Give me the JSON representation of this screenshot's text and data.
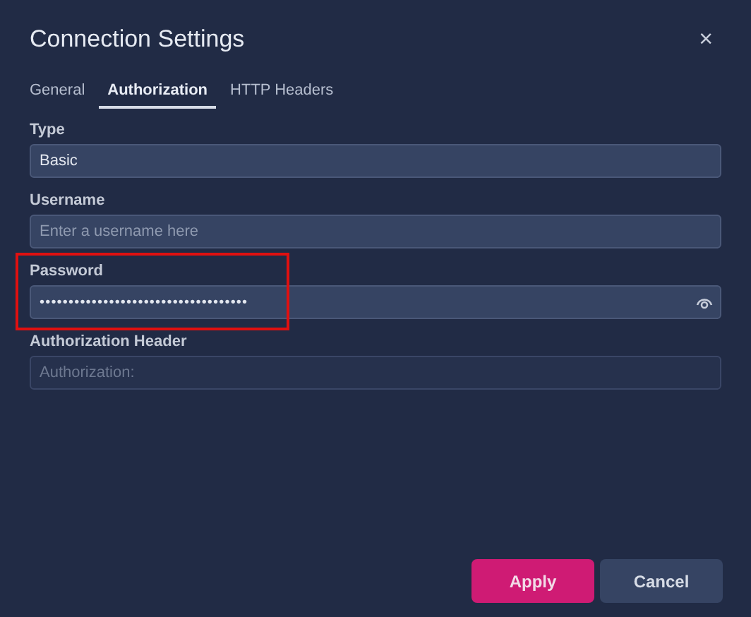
{
  "dialog": {
    "title": "Connection Settings",
    "close": "×"
  },
  "tabs": [
    {
      "label": "General",
      "selected": false
    },
    {
      "label": "Authorization",
      "selected": true
    },
    {
      "label": "HTTP Headers",
      "selected": false
    }
  ],
  "fields": [
    {
      "kind": "text",
      "label": "Type",
      "value": "Basic",
      "disabled": false,
      "highlighted": false
    },
    {
      "kind": "text",
      "label": "Username",
      "placeholder": "Enter a username here",
      "disabled": false,
      "highlighted": false
    },
    {
      "kind": "password",
      "label": "Password",
      "value": "••••••••••••••••••••••••••••••••••••",
      "disabled": false,
      "highlighted": true
    },
    {
      "kind": "text",
      "label": "Authorization Header",
      "placeholder": "Authorization:",
      "disabled": true,
      "highlighted": false
    }
  ],
  "buttons": [
    {
      "label": "Apply",
      "kind": "primary"
    },
    {
      "label": "Cancel",
      "kind": "secondary"
    }
  ]
}
